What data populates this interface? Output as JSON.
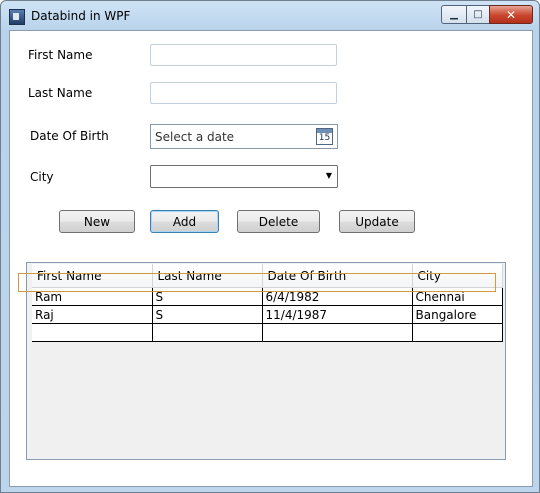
{
  "window": {
    "title": "Databind in WPF"
  },
  "form": {
    "first_name_label": "First Name",
    "last_name_label": "Last Name",
    "dob_label": "Date Of Birth",
    "city_label": "City",
    "first_name_value": "",
    "last_name_value": "",
    "dob_placeholder": "Select a date",
    "calendar_day": "15",
    "city_value": ""
  },
  "buttons": {
    "new": "New",
    "add": "Add",
    "delete": "Delete",
    "update": "Update"
  },
  "grid": {
    "columns": [
      "First Name",
      "Last Name",
      "Date Of Birth",
      "City"
    ],
    "rows": [
      [
        "Ram",
        "S",
        "6/4/1982",
        "Chennai"
      ],
      [
        "Raj",
        "S",
        "11/4/1987",
        "Bangalore"
      ],
      [
        "",
        "",
        "",
        ""
      ]
    ],
    "selected_row": 1
  },
  "colors": {
    "selection_outline": "#d39a3c",
    "grid_background": "#f0f0f0"
  }
}
